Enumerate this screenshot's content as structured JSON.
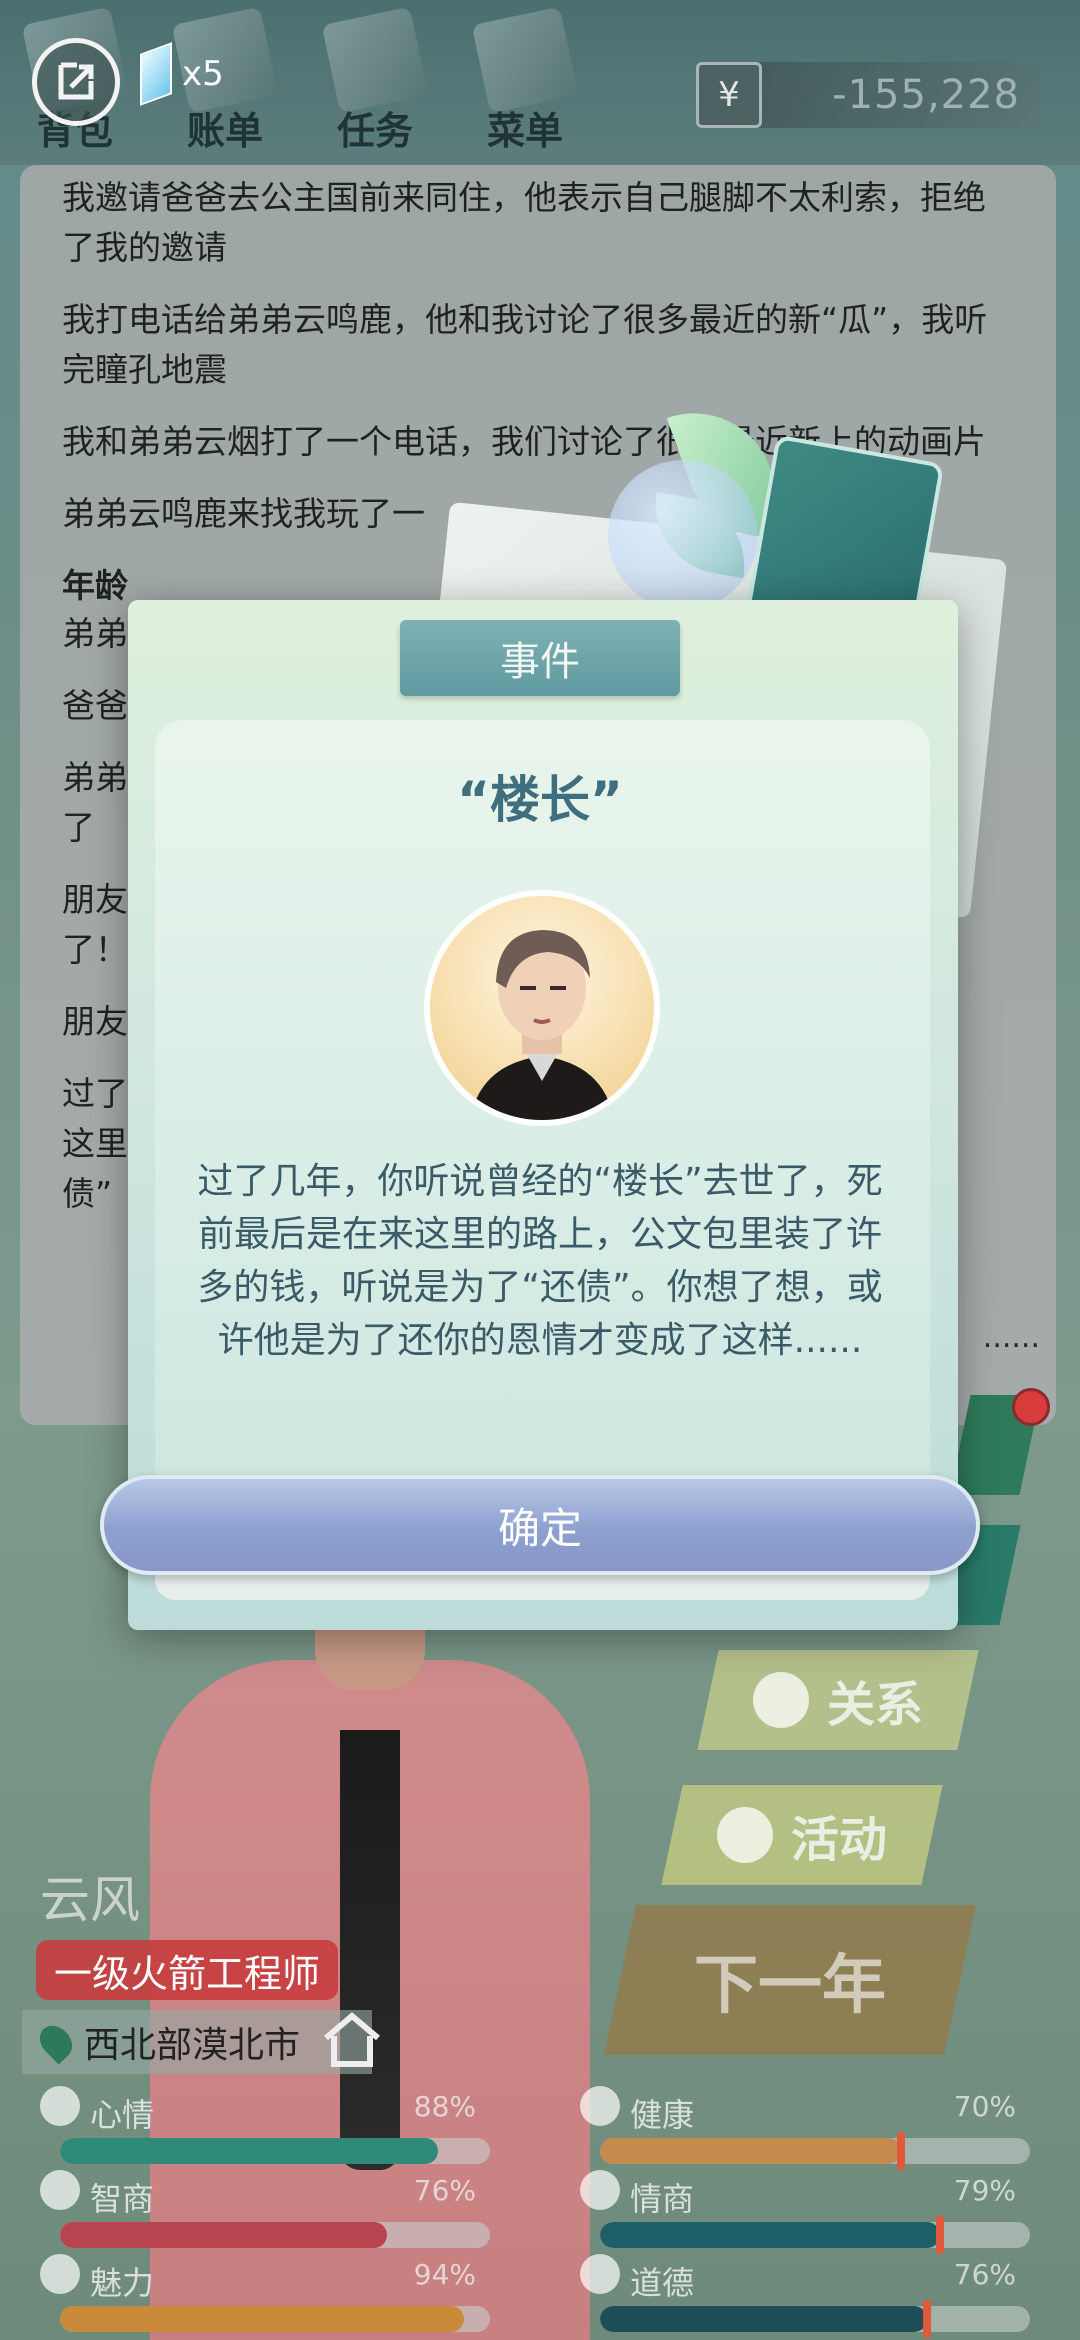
{
  "topbar": {
    "nav": [
      "背包",
      "账单",
      "任务",
      "菜单"
    ],
    "gem_count": "x5",
    "currency_symbol": "¥",
    "money": "-155,228"
  },
  "log": {
    "lines": [
      "我邀请爸爸去公主国前来同住，他表示自己腿脚不太利索，拒绝了我的邀请",
      "我打电话给弟弟云鸣鹿，他和我讨论了很多最近的新“瓜”，我听完瞳孔地震",
      "我和弟弟云烟打了一个电话，我们讨论了很多最近新上的动画片",
      "弟弟云鸣鹿来找我玩了一"
    ],
    "bold_prefix": "年龄",
    "partial": [
      "弟弟",
      "爸爸",
      "弟弟",
      "了",
      "朋友",
      "了！",
      "朋友",
      "过了",
      "这里",
      "债”"
    ],
    "ellipsis": "......"
  },
  "modal": {
    "tab_label": "事件",
    "title": "“楼长”",
    "text": "过了几年，你听说曾经的“楼长”去世了，死前最后是在来这里的路上，公文包里装了许多的钱，听说是为了“还债”。你想了想，或许他是为了还你的恩情才变成了这样......",
    "confirm_label": "确定"
  },
  "side_menu": {
    "relation": "关系",
    "activity": "活动",
    "next_year": "下一年"
  },
  "character": {
    "name": "云风",
    "title": "一级火箭工程师",
    "location": "西北部漠北市"
  },
  "stats": [
    {
      "label": "心情",
      "value": "88%",
      "fraction": 0.88,
      "color": "#2f8a78",
      "icon": "smile-icon"
    },
    {
      "label": "健康",
      "value": "70%",
      "fraction": 0.7,
      "color": "#c58a4e",
      "icon": "heart-icon"
    },
    {
      "label": "智商",
      "value": "76%",
      "fraction": 0.76,
      "color": "#b8444f",
      "icon": "bulb-icon"
    },
    {
      "label": "情商",
      "value": "79%",
      "fraction": 0.79,
      "color": "#1f5f6a",
      "icon": "apple-icon"
    },
    {
      "label": "魅力",
      "value": "94%",
      "fraction": 0.94,
      "color": "#c98a3a",
      "icon": "star-icon"
    },
    {
      "label": "道德",
      "value": "76%",
      "fraction": 0.76,
      "color": "#1e4f58",
      "icon": "scale-icon"
    }
  ]
}
